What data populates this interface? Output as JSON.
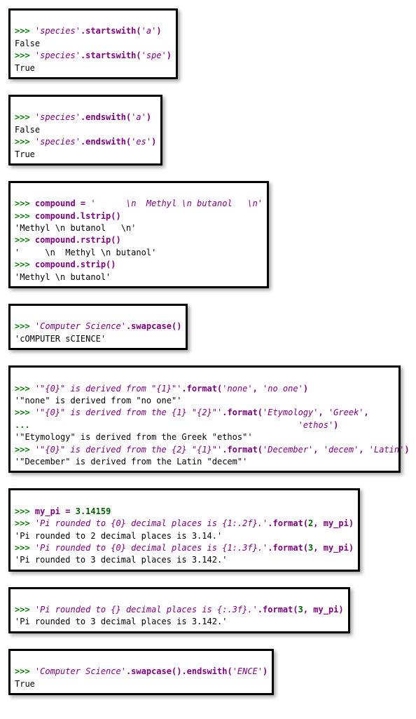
{
  "prompt": ">>> ",
  "cont": "... ",
  "b1": {
    "l1p": "'species'",
    "l1m": ".startswith(",
    "l1a": "'a'",
    "l1c": ")",
    "o1": "False",
    "l2p": "'species'",
    "l2m": ".startswith(",
    "l2a": "'spe'",
    "l2c": ")",
    "o2": "True"
  },
  "b2": {
    "l1p": "'species'",
    "l1m": ".endswith(",
    "l1a": "'a'",
    "l1c": ")",
    "o1": "False",
    "l2p": "'species'",
    "l2m": ".endswith(",
    "l2a": "'es'",
    "l2c": ")",
    "o2": "True"
  },
  "b3": {
    "l1a": "compound",
    "l1eq": " = ",
    "l1s": "'      \\n  Methyl \\n butanol   \\n'",
    "l2a": "compound",
    "l2m": ".lstrip()",
    "o2": "'Methyl \\n butanol   \\n'",
    "l3a": "compound",
    "l3m": ".rstrip()",
    "o3": "'     \\n  Methyl \\n butanol'",
    "l4a": "compound",
    "l4m": ".strip()",
    "o4": "'Methyl \\n butanol'"
  },
  "b4": {
    "l1s": "'Computer Science'",
    "l1m": ".swapcase()",
    "o1": "'cOMPUTER sCIENCE'"
  },
  "b5": {
    "l1s": "'\"{0}\" is derived from \"{1}\"'",
    "l1m": ".format(",
    "l1a1": "'none'",
    "l1sep": ", ",
    "l1a2": "'no one'",
    "l1c": ")",
    "o1": "'\"none\" is derived from \"no one\"'",
    "l2s": "'\"{0}\" is derived from the {1} \"{2}\"'",
    "l2m": ".format(",
    "l2a1": "'Etymology'",
    "l2sep": ", ",
    "l2a2": "'Greek'",
    "l2c2": ",",
    "l2cont_pad": "                                                    ",
    "l2a3": "'ethos'",
    "l2c": ")",
    "o2": "'\"Etymology\" is derived from the Greek \"ethos\"'",
    "l3s": "'\"{0}\" is derived from the {2} \"{1}\"'",
    "l3m": ".format(",
    "l3a1": "'December'",
    "l3sep": ", ",
    "l3a2": "'decem'",
    "l3sep2": ", ",
    "l3a3": "'Latin'",
    "l3c": ")",
    "o3": "'\"December\" is derived from the Latin \"decem\"'"
  },
  "b6": {
    "l1a": "my_pi",
    "l1eq": " = ",
    "l1n": "3.14159",
    "l2s": "'Pi rounded to {0} decimal places is {1:.2f}.'",
    "l2m": ".format(",
    "l2n": "2",
    "l2sep": ", ",
    "l2id": "my_pi",
    "l2c": ")",
    "o2": "'Pi rounded to 2 decimal places is 3.14.'",
    "l3s": "'Pi rounded to {0} decimal places is {1:.3f}.'",
    "l3m": ".format(",
    "l3n": "3",
    "l3sep": ", ",
    "l3id": "my_pi",
    "l3c": ")",
    "o3": "'Pi rounded to 3 decimal places is 3.142.'"
  },
  "b7": {
    "l1s": "'Pi rounded to {} decimal places is {:.3f}.'",
    "l1m": ".format(",
    "l1n": "3",
    "l1sep": ", ",
    "l1id": "my_pi",
    "l1c": ")",
    "o1": "'Pi rounded to 3 decimal places is 3.142.'"
  },
  "b8": {
    "l1s": "'Computer Science'",
    "l1m1": ".swapcase()",
    "l1m2": ".endswith(",
    "l1a": "'ENCE'",
    "l1c": ")",
    "o1": "True"
  }
}
